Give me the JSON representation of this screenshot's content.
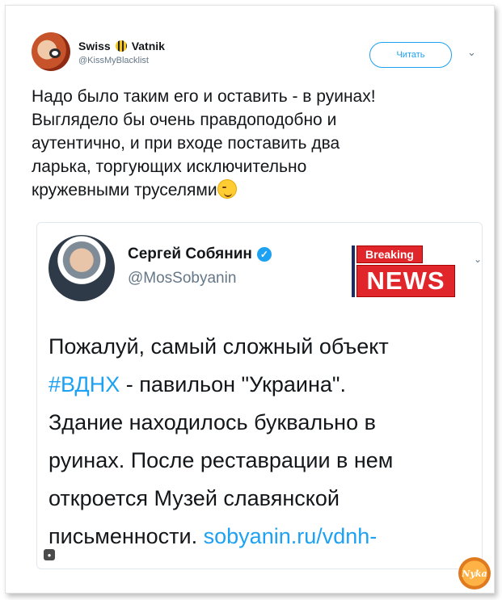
{
  "author": {
    "name_left": "Swiss",
    "name_right": "Vatnik",
    "handle": "@KissMyBlacklist"
  },
  "follow_button": {
    "label": "Читать"
  },
  "tweet": {
    "lines": [
      "Надо было таким его и оставить - в руинах!",
      "Выглядело бы очень правдоподобно и",
      "аутентично, и при входе поставить два",
      "ларька, торгующих исключительно",
      "кружевными труселями"
    ]
  },
  "quoted": {
    "name": "Сергей Собянин",
    "handle": "@MosSobyanin",
    "badge": {
      "top": "Breaking",
      "bottom": "NEWS"
    },
    "text": {
      "line1": "Пожалуй, самый сложный объект",
      "hashtag": "#ВДНХ",
      "line2_rest": " - павильон \"Украина\".",
      "line3": "Здание находилось буквально в",
      "line4": "руинах. После реставрации в нем",
      "line5": "откроется Музей славянской",
      "line6": "письменности. ",
      "link": "sobyanin.ru/vdnh-"
    }
  },
  "icons": {
    "chevron": "chevron-down-icon",
    "verified": "verified-badge-icon",
    "emoji": "winking-face-icon"
  },
  "colors": {
    "accent": "#1da1f2",
    "text": "#14171a",
    "muted": "#657786",
    "breaking": "#e0262b"
  }
}
